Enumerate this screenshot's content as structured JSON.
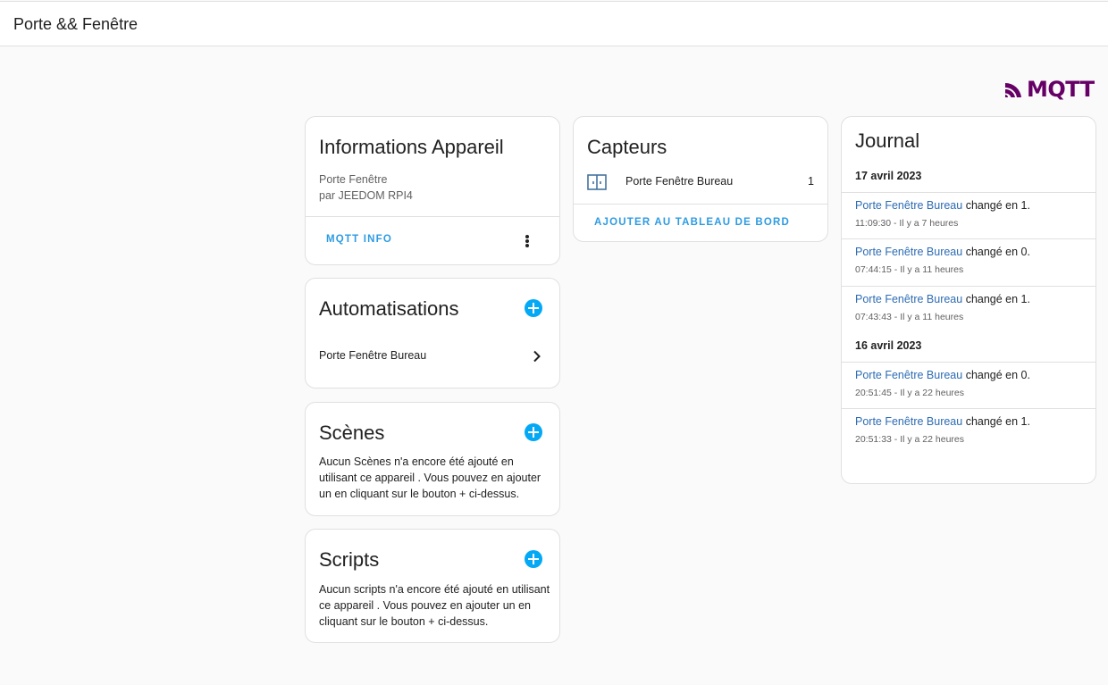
{
  "header": {
    "title": "Porte && Fenêtre"
  },
  "brand": {
    "logo_text": "MQTT",
    "color": "#660066"
  },
  "device_info": {
    "title": "Informations Appareil",
    "model": "Porte Fenêtre",
    "manufacturer": "par JEEDOM RPI4",
    "action_label": "MQTT INFO"
  },
  "automations": {
    "title": "Automatisations",
    "items": [
      {
        "label": "Porte Fenêtre Bureau"
      }
    ]
  },
  "scenes": {
    "title": "Scènes",
    "empty_text": "Aucun Scènes n'a encore été ajouté en utilisant ce appareil . Vous pouvez en ajouter un en cliquant sur le bouton + ci-dessus."
  },
  "scripts": {
    "title": "Scripts",
    "empty_text": "Aucun scripts n'a encore été ajouté en utilisant ce appareil . Vous pouvez en ajouter un en cliquant sur le bouton + ci-dessus."
  },
  "sensors": {
    "title": "Capteurs",
    "items": [
      {
        "name": "Porte Fenêtre Bureau",
        "value": "1",
        "icon": "door-window-icon"
      }
    ],
    "action_label": "AJOUTER AU TABLEAU DE BORD"
  },
  "logbook": {
    "title": "Journal",
    "groups": [
      {
        "date": "17 avril 2023",
        "entries": [
          {
            "entity": "Porte Fenêtre Bureau",
            "message": "changé en 1.",
            "time": "11:09:30 - Il y a 7 heures"
          },
          {
            "entity": "Porte Fenêtre Bureau",
            "message": "changé en 0.",
            "time": "07:44:15 - Il y a 11 heures"
          },
          {
            "entity": "Porte Fenêtre Bureau",
            "message": "changé en 1.",
            "time": "07:43:43 - Il y a 11 heures"
          }
        ]
      },
      {
        "date": "16 avril 2023",
        "entries": [
          {
            "entity": "Porte Fenêtre Bureau",
            "message": "changé en 0.",
            "time": "20:51:45 - Il y a 22 heures"
          },
          {
            "entity": "Porte Fenêtre Bureau",
            "message": "changé en 1.",
            "time": "20:51:33 - Il y a 22 heures"
          }
        ]
      }
    ]
  }
}
